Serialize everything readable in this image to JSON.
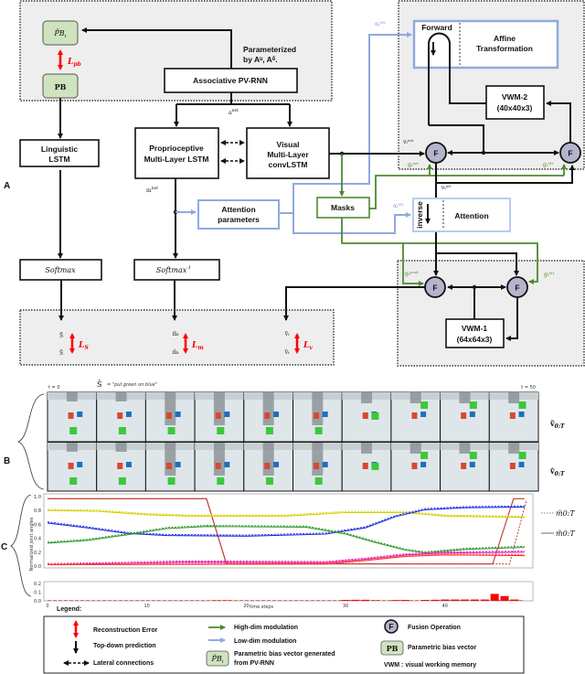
{
  "panel_labels": {
    "a": "A",
    "b": "B",
    "c": "C"
  },
  "diagram": {
    "pb_tilde": {
      "main": "P̃B",
      "sub": "t"
    },
    "pb": "PB",
    "loss_pb": {
      "main": "L",
      "sub": "pb"
    },
    "parameterized_line1": "Parameterized",
    "parameterized_line2": "by Aᵘ, Aᵟ.",
    "pvrnn": "Associative PV-RNN",
    "a_net": {
      "main": "a",
      "sup": "net",
      "sub": "t"
    },
    "linguistic_lstm": [
      "Linguistic",
      "LSTM"
    ],
    "proprioceptive_lstm": [
      "Proprioceptive",
      "Multi-Layer LSTM"
    ],
    "visual_lstm": [
      "Visual",
      "Multi-Layer",
      "convLSTM"
    ],
    "m_net": {
      "main": "m",
      "sup": "net",
      "sub": "t"
    },
    "attention_parameters": [
      "Attention",
      "parameters"
    ],
    "masks": "Masks",
    "softmax": "Softmax",
    "softmax_inv": "Softmax",
    "softmax_inv_sup": "-1",
    "forward": "Forward",
    "affine": [
      "Affine",
      "Transformation"
    ],
    "vwm2": [
      "VWM-2",
      "(40x40x3)"
    ],
    "vwm1": [
      "VWM-1",
      "(64x64x3)"
    ],
    "inverse": "inverse",
    "attention": "Attention",
    "fusion_label": "F",
    "alpha_m2": "αₜᴹ²",
    "alpha_m1": "αₜᴹ¹",
    "v_net": "vₜⁿᵉᵗ",
    "v_att": "vₜᵃᵗᵗ",
    "g_net": "gₜⁿᵉᵗ",
    "g_m2": "gₜᴹ²",
    "g_prod": "gₜᵖʳᵒᵈ",
    "g_m1": "gₜᴹ¹",
    "outputs": {
      "s_tilde": "S̃",
      "s_hat": "Ŝ",
      "loss_s": {
        "main": "L",
        "sub": "S"
      },
      "m_tilde": "m̃ₜ",
      "m_hat": "m̂ₜ",
      "loss_m": {
        "main": "L",
        "sub": "m"
      },
      "v_tilde": "ṽₜ",
      "v_hat": "v̂ₜ",
      "loss_v": {
        "main": "L",
        "sub": "v"
      }
    },
    "colors": {
      "high_dim": "#4b8a2e",
      "low_dim": "#8eabdf",
      "fusion": "#b4b4cc",
      "pb_box": "#cfe3bf",
      "error": "#ff0000",
      "panel": "#eeeeee"
    }
  },
  "frames": {
    "t_start": "t = 0",
    "t_end": "t = 50",
    "sentence_label": "Ŝ",
    "sentence": "= \"put green on blue\"",
    "row_top_label": "ṽ",
    "row_top_sub": "0:T",
    "row_bottom_label": "v̂",
    "row_bottom_sub": "0:T",
    "count": 10
  },
  "chart_data": {
    "type": "line",
    "ylabel": "Normalized joint angles",
    "xlabel": "time steps",
    "xlim": [
      0,
      49
    ],
    "ylim": [
      0,
      1.0
    ],
    "xticks": [
      "0",
      "10",
      "20",
      "30",
      "40"
    ],
    "yticks": [
      "0.0",
      "0.2",
      "0.4",
      "0.6",
      "0.8",
      "1.0"
    ],
    "grid": false,
    "legend": {
      "position": "right",
      "dashed": "m̃0:T",
      "solid": "m̂0:T"
    },
    "series": [
      {
        "color": "#c0392b",
        "style": "solid",
        "points": [
          [
            0,
            0.97
          ],
          [
            16,
            0.97
          ],
          [
            18,
            0.03
          ],
          [
            44.8,
            0.03
          ],
          [
            46.9,
            0.97
          ],
          [
            48,
            0.97
          ]
        ]
      },
      {
        "color": "#c0392b",
        "style": "dashed",
        "points": [
          [
            0,
            0.97
          ],
          [
            16,
            0.97
          ],
          [
            18,
            0.04
          ],
          [
            46.5,
            0.03
          ],
          [
            48.2,
            0.95
          ]
        ]
      },
      {
        "color": "#d4d000",
        "style": "both",
        "points": [
          [
            0,
            0.8
          ],
          [
            5,
            0.79
          ],
          [
            10,
            0.74
          ],
          [
            14,
            0.72
          ],
          [
            24,
            0.72
          ],
          [
            30,
            0.77
          ],
          [
            36,
            0.77
          ],
          [
            40,
            0.72
          ],
          [
            48,
            0.7
          ]
        ]
      },
      {
        "color": "#1f2ee0",
        "style": "both",
        "points": [
          [
            0,
            0.62
          ],
          [
            4,
            0.55
          ],
          [
            8,
            0.47
          ],
          [
            12,
            0.44
          ],
          [
            20,
            0.43
          ],
          [
            28,
            0.46
          ],
          [
            32,
            0.55
          ],
          [
            35,
            0.71
          ],
          [
            38,
            0.81
          ],
          [
            42,
            0.84
          ],
          [
            48,
            0.85
          ]
        ]
      },
      {
        "color": "#2e9a2e",
        "style": "both",
        "points": [
          [
            0,
            0.33
          ],
          [
            4,
            0.37
          ],
          [
            8,
            0.45
          ],
          [
            12,
            0.54
          ],
          [
            16,
            0.57
          ],
          [
            26,
            0.56
          ],
          [
            30,
            0.46
          ],
          [
            33,
            0.34
          ],
          [
            36,
            0.23
          ],
          [
            38,
            0.19
          ],
          [
            42,
            0.24
          ],
          [
            48,
            0.27
          ]
        ]
      },
      {
        "color": "#e020c8",
        "style": "both",
        "points": [
          [
            0,
            0.02
          ],
          [
            8,
            0.04
          ],
          [
            14,
            0.06
          ],
          [
            28,
            0.05
          ],
          [
            32,
            0.1
          ],
          [
            36,
            0.16
          ],
          [
            40,
            0.19
          ],
          [
            48,
            0.2
          ]
        ]
      },
      {
        "color": "#ff3030",
        "style": "both",
        "points": [
          [
            0,
            0.02
          ],
          [
            28,
            0.03
          ],
          [
            32,
            0.08
          ],
          [
            36,
            0.14
          ],
          [
            40,
            0.16
          ],
          [
            48,
            0.15
          ]
        ]
      }
    ],
    "error_bars": {
      "ylim": [
        0,
        0.2
      ],
      "yticks": [
        "0.0",
        "0.1",
        "0.2"
      ],
      "color": "#ff0000",
      "points": [
        [
          17,
          0.005
        ],
        [
          18,
          0.005
        ],
        [
          30,
          0.01
        ],
        [
          31,
          0.012
        ],
        [
          32,
          0.012
        ],
        [
          33,
          0.006
        ],
        [
          35,
          0.008
        ],
        [
          36,
          0.01
        ],
        [
          38,
          0.01
        ],
        [
          39,
          0.012
        ],
        [
          40,
          0.015
        ],
        [
          41,
          0.015
        ],
        [
          42,
          0.015
        ],
        [
          43,
          0.015
        ],
        [
          44,
          0.015
        ],
        [
          45,
          0.08
        ],
        [
          46,
          0.055
        ],
        [
          47,
          0.015
        ]
      ]
    }
  },
  "legend": {
    "title": "Legend:",
    "reconstruction_error": "Reconstruction Error",
    "top_down": "Top-down prediction",
    "lateral": "Lateral connections",
    "high_dim": "High-dim modulation",
    "low_dim": "Low-dim modulation",
    "pb_generated": [
      "Parametric bias vector generated",
      "from PV-RNN"
    ],
    "fusion": "Fusion Operation",
    "pb": "Parametric bias vector",
    "vwm": "VWM : visual working memory"
  }
}
